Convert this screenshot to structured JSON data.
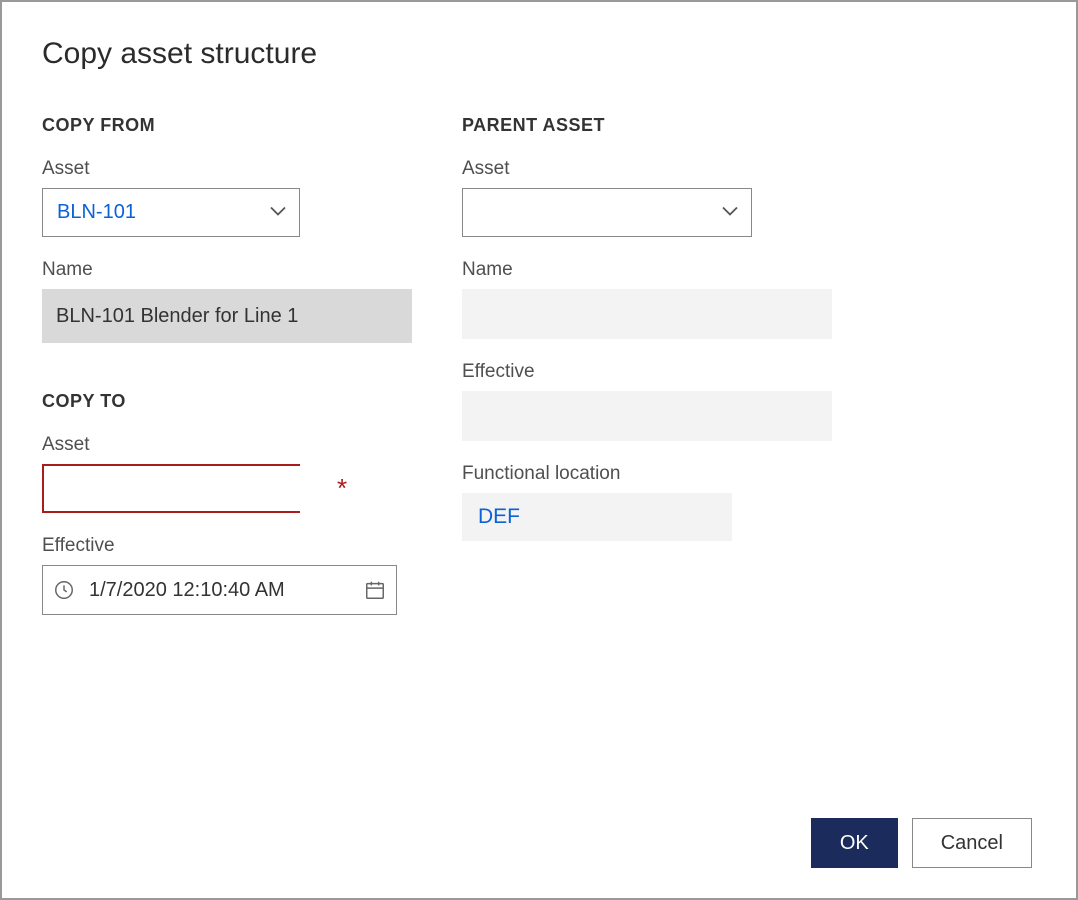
{
  "dialog": {
    "title": "Copy asset structure"
  },
  "copy_from": {
    "header": "COPY FROM",
    "asset_label": "Asset",
    "asset_value": "BLN-101",
    "name_label": "Name",
    "name_value": "BLN-101 Blender for Line 1"
  },
  "copy_to": {
    "header": "COPY TO",
    "asset_label": "Asset",
    "asset_value": "",
    "effective_label": "Effective",
    "effective_value": "1/7/2020 12:10:40 AM"
  },
  "parent_asset": {
    "header": "PARENT ASSET",
    "asset_label": "Asset",
    "asset_value": "",
    "name_label": "Name",
    "name_value": "",
    "effective_label": "Effective",
    "effective_value": "",
    "funcloc_label": "Functional location",
    "funcloc_value": "DEF"
  },
  "buttons": {
    "ok": "OK",
    "cancel": "Cancel"
  }
}
